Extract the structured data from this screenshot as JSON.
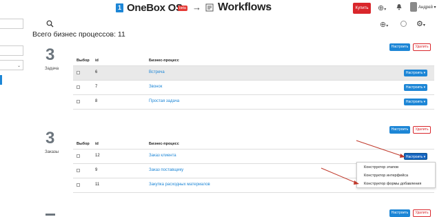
{
  "topbar": {
    "logo_num": "1",
    "brand": "OneBox OS",
    "beta": "beta",
    "arrow": "→",
    "app_title": "Workflows",
    "caret": "▾",
    "buy_label": "Купить",
    "plus": "⊕",
    "plus_caret": "▾",
    "username": "Андрей",
    "user_caret": "▾"
  },
  "page": {
    "title": "Всего бизнес процессов: 11",
    "header_plus": "⊕",
    "header_plus_caret": "▾",
    "gear": "⚙",
    "gear_caret": "▾"
  },
  "columns": {
    "select": "Выбор",
    "id": "id",
    "process": "Бизнес-процесс"
  },
  "buttons": {
    "configure": "Настроить",
    "delete": "Удалить",
    "row_configure": "Настроить ▾"
  },
  "sections": [
    {
      "number": "3",
      "label": "Задача",
      "rows": [
        {
          "id": "6",
          "name": "Встреча"
        },
        {
          "id": "7",
          "name": "Звонок"
        },
        {
          "id": "8",
          "name": "Простая задача"
        }
      ]
    },
    {
      "number": "3",
      "label": "Заказы",
      "rows": [
        {
          "id": "12",
          "name": "Заказ клиента"
        },
        {
          "id": "9",
          "name": "Заказ поставщику"
        },
        {
          "id": "11",
          "name": "Закупка расходных материалов"
        }
      ]
    }
  ],
  "dropdown": {
    "items": [
      "Конструктор этапов",
      "Конструктор интерфейса",
      "Конструктор формы добавления"
    ]
  },
  "colors": {
    "accent": "#1d86d6",
    "danger": "#d9262b",
    "annotation": "#c0392b"
  },
  "icons": {
    "search": "search-icon",
    "bell": "bell-icon",
    "gear": "gear-icon",
    "workflow": "workflow-icon"
  }
}
